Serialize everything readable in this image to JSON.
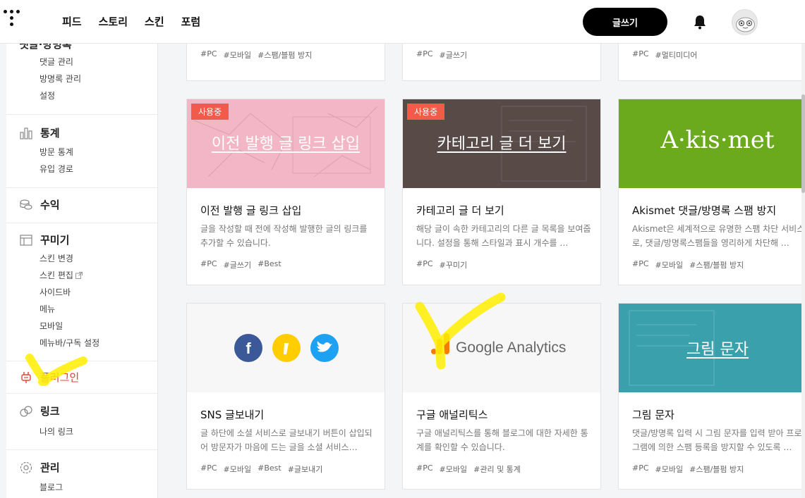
{
  "header": {
    "nav": [
      "피드",
      "스토리",
      "스킨",
      "포럼"
    ],
    "write_label": "글쓰기"
  },
  "sidebar": {
    "top_cut": "댓글·방명록",
    "top_items": [
      "댓글 관리",
      "방명록 관리",
      "설정"
    ],
    "stats": {
      "label": "통계",
      "items": [
        "방문 통계",
        "유입 경로"
      ]
    },
    "revenue": {
      "label": "수익"
    },
    "customize": {
      "label": "꾸미기",
      "items": [
        "스킨 변경",
        "스킨 편집",
        "사이드바",
        "메뉴",
        "모바일",
        "메뉴바/구독 설정"
      ]
    },
    "plugin": {
      "label": "플러그인",
      "active_color": "#e8412c"
    },
    "link": {
      "label": "링크",
      "items": [
        "나의 링크"
      ]
    },
    "manage": {
      "label": "관리",
      "items": [
        "블로그"
      ]
    }
  },
  "cards": {
    "top": [
      {
        "tags": [
          "#PC",
          "#모바일",
          "#스팸/블펌 방지"
        ]
      },
      {
        "tags": [
          "#PC",
          "#글쓰기"
        ]
      },
      {
        "tags": [
          "#PC",
          "#멀티미디어"
        ]
      }
    ],
    "row1": [
      {
        "badge": "사용중",
        "thumb_text": "이전 발행 글 링크 삽입",
        "title": "이전 발행 글 링크 삽입",
        "desc": "글을 작성할 때 전에 작성해 발행한 글의 링크를 추가할 수 있습니다.",
        "tags": [
          "#PC",
          "#글쓰기",
          "#Best"
        ]
      },
      {
        "badge": "사용중",
        "thumb_text": "카테고리 글 더 보기",
        "title": "카테고리 글 더 보기",
        "desc": "해당 글이 속한 카테고리의 다른 글 목록을 보여줍니다. 설정을 통해 스타일과 표시 개수를 …",
        "tags": [
          "#PC",
          "#꾸미기"
        ]
      },
      {
        "thumb_text": "A·kis·met",
        "title": "Akismet 댓글/방명록 스팸 방지",
        "desc": "Akismet은 세계적으로 유명한 스팸 차단 서비스로, 댓글/방명록스팸들을 영리하게 차단해 …",
        "tags": [
          "#PC",
          "#모바일",
          "#스팸/블펌 방지"
        ]
      }
    ],
    "row2": [
      {
        "title": "SNS 글보내기",
        "desc": "글 하단에 소셜 서비스로 글보내기 버튼이 삽입되어 방문자가 마음에 드는 글을 소셜 서비스…",
        "tags": [
          "#PC",
          "#모바일",
          "#Best",
          "#글보내기"
        ]
      },
      {
        "thumb_text": "Google Analytics",
        "title": "구글 애널리틱스",
        "desc": "구글 애널리틱스를 통해 블로그에 대한 자세한 통계를 확인할 수 있습니다.",
        "tags": [
          "#PC",
          "#모바일",
          "#관리 및 통계"
        ]
      },
      {
        "thumb_text": "그림 문자",
        "title": "그림 문자",
        "desc": "댓글/방명록 입력 시 그림 문자를 입력 받아 프로그램에 의한 스팸 등록을 방지할 수 있도록 …",
        "tags": [
          "#PC",
          "#모바일",
          "#스팸/블펌 방지"
        ]
      }
    ]
  },
  "colors": {
    "thumb_pink": "#f2b6c6",
    "thumb_brown": "#574a47",
    "thumb_green": "#6aaa1c",
    "thumb_teal": "#3aa1ac",
    "facebook": "#3b5998",
    "kakao": "#ffcd00",
    "twitter": "#1da1f2"
  }
}
